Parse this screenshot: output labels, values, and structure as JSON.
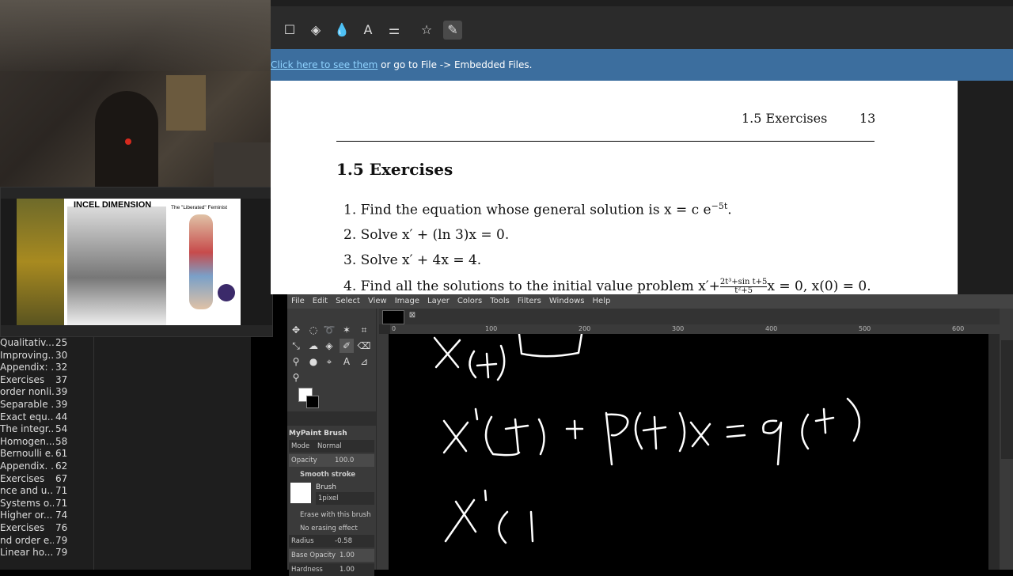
{
  "thumbnail": {
    "title_text": "INCEL DIMENSION",
    "subtitle_text": "The \"Liberated\" Feminist"
  },
  "outline": [
    {
      "title": "Qualitativ...",
      "page": "25"
    },
    {
      "title": "Improving...",
      "page": "30"
    },
    {
      "title": "Appendix: ...",
      "page": "32"
    },
    {
      "title": "Exercises",
      "page": "37"
    },
    {
      "title": "order nonli...",
      "page": "39"
    },
    {
      "title": "Separable ...",
      "page": "39"
    },
    {
      "title": "Exact equ...",
      "page": "44"
    },
    {
      "title": "The integr...",
      "page": "54"
    },
    {
      "title": "Homogen...",
      "page": "58"
    },
    {
      "title": "Bernoulli e...",
      "page": "61"
    },
    {
      "title": "Appendix. ...",
      "page": "62"
    },
    {
      "title": "Exercises",
      "page": "67"
    },
    {
      "title": "nce and u...",
      "page": "71"
    },
    {
      "title": "Systems o...",
      "page": "71"
    },
    {
      "title": "Higher or...",
      "page": "74"
    },
    {
      "title": "Exercises",
      "page": "76"
    },
    {
      "title": "nd order e...",
      "page": "79"
    },
    {
      "title": "Linear ho...",
      "page": "79"
    }
  ],
  "pdf": {
    "notice_link": "Click here to see them",
    "notice_text": " or go to File -> Embedded Files.",
    "header_section": "1.5  Exercises",
    "header_page": "13",
    "section_title": "1.5  Exercises",
    "items": [
      {
        "num": "1.",
        "text": "Find the equation whose general solution is x = c e",
        "sup": "−5t",
        "tail": "."
      },
      {
        "num": "2.",
        "text": "Solve x′ + (ln 3)x = 0.",
        "sup": "",
        "tail": ""
      },
      {
        "num": "3.",
        "text": "Solve x′ + 4x = 4.",
        "sup": "",
        "tail": ""
      },
      {
        "num": "4.",
        "text": "Find all the solutions to the initial value problem x′+",
        "sup": "",
        "tail": "x = 0, x(0) = 0."
      }
    ],
    "item4_fraction_num": "2t³+sin t+5",
    "item4_fraction_den": "t²+5"
  },
  "gimp": {
    "menu": [
      "File",
      "Edit",
      "Select",
      "View",
      "Image",
      "Layer",
      "Colors",
      "Tools",
      "Filters",
      "Windows",
      "Help"
    ],
    "brush_panel_title": "MyPaint Brush",
    "mode_label": "Mode",
    "mode_value": "Normal",
    "opacity_label": "Opacity",
    "opacity_value": "100.0",
    "smooth_stroke_label": "Smooth stroke",
    "brush_label": "Brush",
    "brush_value": "1pixel",
    "erase_label": "Erase with this brush",
    "no_erasing_label": "No erasing effect",
    "radius_label": "Radius",
    "radius_value": "-0.58",
    "base_opacity_label": "Base Opacity",
    "base_opacity_value": "1.00",
    "hardness_label": "Hardness",
    "hardness_value": "1.00",
    "ruler_ticks": [
      "0",
      "100",
      "200",
      "300",
      "400",
      "500",
      "600"
    ]
  }
}
